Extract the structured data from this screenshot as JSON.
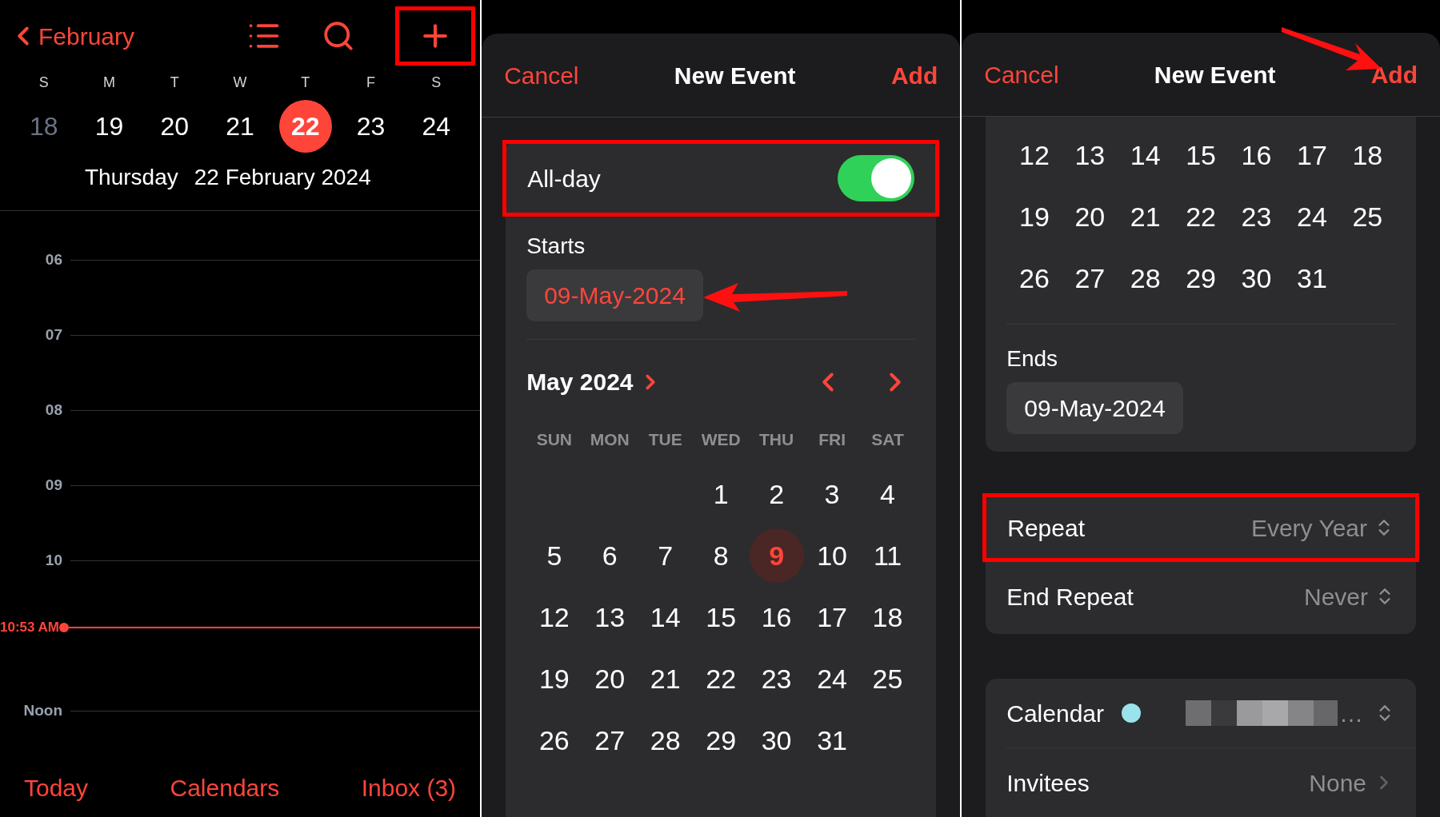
{
  "day_view": {
    "back_label": "February",
    "plus_highlighted": true,
    "weekdays": [
      "S",
      "M",
      "T",
      "W",
      "T",
      "F",
      "S"
    ],
    "dates": [
      {
        "d": "18",
        "selected": false,
        "dimmed": true
      },
      {
        "d": "19",
        "selected": false,
        "dimmed": false
      },
      {
        "d": "20",
        "selected": false,
        "dimmed": false
      },
      {
        "d": "21",
        "selected": false,
        "dimmed": false
      },
      {
        "d": "22",
        "selected": true,
        "dimmed": false
      },
      {
        "d": "23",
        "selected": false,
        "dimmed": false
      },
      {
        "d": "24",
        "selected": false,
        "dimmed": false
      }
    ],
    "weekday_name": "Thursday",
    "full_date": "22 February 2024",
    "timeline": [
      {
        "kind": "hour",
        "label": "06"
      },
      {
        "kind": "hour",
        "label": "07"
      },
      {
        "kind": "hour",
        "label": "08"
      },
      {
        "kind": "hour",
        "label": "09"
      },
      {
        "kind": "hour",
        "label": "10"
      },
      {
        "kind": "now",
        "label": "10:53 AM"
      },
      {
        "kind": "hour",
        "label": "Noon"
      }
    ],
    "tabs": [
      "Today",
      "Calendars",
      "Inbox (3)"
    ]
  },
  "new_event": {
    "cancel": "Cancel",
    "title": "New Event",
    "add": "Add",
    "all_day": {
      "label": "All-day",
      "on": true,
      "highlighted": true
    },
    "starts": {
      "label": "Starts",
      "value": "09-May-2024",
      "arrow": true
    },
    "month": "May 2024",
    "weekdays": [
      "SUN",
      "MON",
      "TUE",
      "WED",
      "THU",
      "FRI",
      "SAT"
    ],
    "weeks": [
      {
        "kind": "ends",
        "days": [
          {
            "d": "1",
            "selected": false
          },
          {
            "d": "2",
            "selected": false
          },
          {
            "d": "3",
            "selected": false
          },
          {
            "d": "4",
            "selected": false
          }
        ]
      },
      {
        "days": [
          {
            "d": "5",
            "selected": false
          },
          {
            "d": "6",
            "selected": false
          },
          {
            "d": "7",
            "selected": false
          },
          {
            "d": "8",
            "selected": false
          },
          {
            "d": "9",
            "selected": true
          },
          {
            "d": "10",
            "selected": false
          },
          {
            "d": "11",
            "selected": false
          }
        ]
      },
      {
        "days": [
          {
            "d": "12",
            "selected": false
          },
          {
            "d": "13",
            "selected": false
          },
          {
            "d": "14",
            "selected": false
          },
          {
            "d": "15",
            "selected": false
          },
          {
            "d": "16",
            "selected": false
          },
          {
            "d": "17",
            "selected": false
          },
          {
            "d": "18",
            "selected": false
          }
        ]
      },
      {
        "days": [
          {
            "d": "19",
            "selected": false
          },
          {
            "d": "20",
            "selected": false
          },
          {
            "d": "21",
            "selected": false
          },
          {
            "d": "22",
            "selected": false
          },
          {
            "d": "23",
            "selected": false
          },
          {
            "d": "24",
            "selected": false
          },
          {
            "d": "25",
            "selected": false
          }
        ]
      },
      {
        "kind": "starts",
        "days": [
          {
            "d": "26",
            "selected": false
          },
          {
            "d": "27",
            "selected": false
          },
          {
            "d": "28",
            "selected": false
          },
          {
            "d": "29",
            "selected": false
          },
          {
            "d": "30",
            "selected": false
          },
          {
            "d": "31",
            "selected": false
          }
        ]
      }
    ]
  },
  "new_event_scrolled": {
    "cancel": "Cancel",
    "title": "New Event",
    "add": "Add",
    "add_arrow": true,
    "weeks": [
      {
        "days": [
          "12",
          "13",
          "14",
          "15",
          "16",
          "17",
          "18"
        ]
      },
      {
        "days": [
          "19",
          "20",
          "21",
          "22",
          "23",
          "24",
          "25"
        ]
      },
      {
        "days": [
          "26",
          "27",
          "28",
          "29",
          "30",
          "31"
        ]
      }
    ],
    "ends": {
      "label": "Ends",
      "value": "09-May-2024"
    },
    "repeat": {
      "label": "Repeat",
      "value": "Every Year",
      "highlighted": true
    },
    "end_repeat": {
      "label": "End Repeat",
      "value": "Never"
    },
    "calendar": {
      "label": "Calendar",
      "color": "#9be3ea",
      "value": "…"
    },
    "invitees": {
      "label": "Invitees",
      "value": "None"
    }
  }
}
